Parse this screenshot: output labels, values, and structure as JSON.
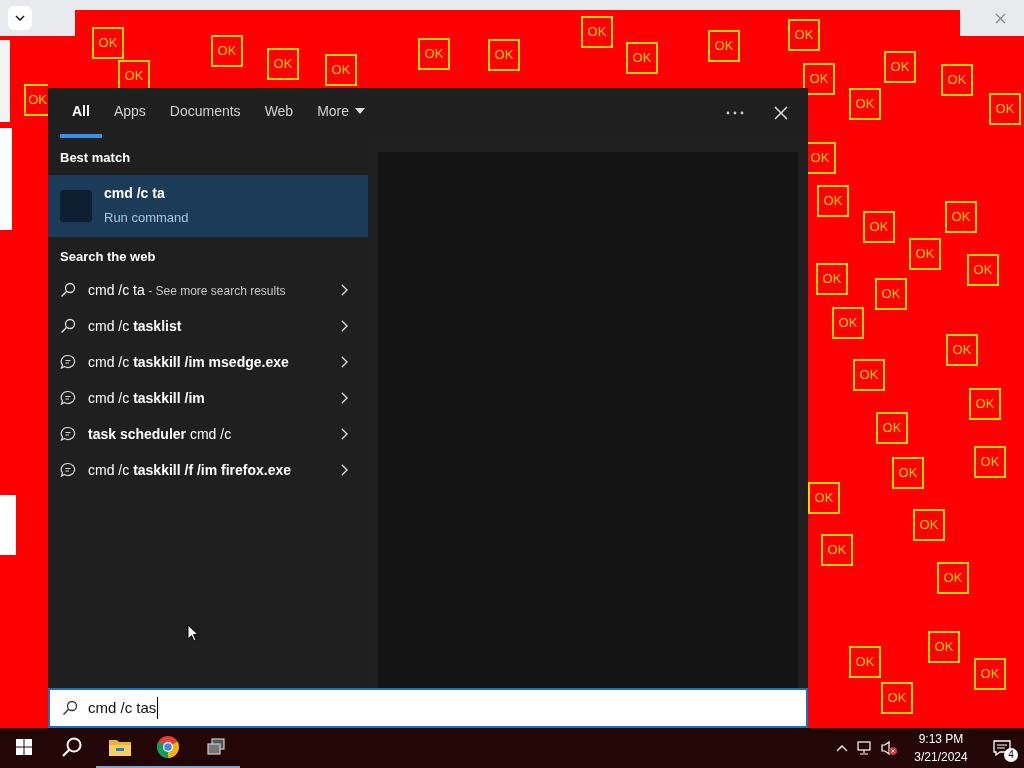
{
  "desktop": {
    "ok_buttons": [
      {
        "label": "OK"
      },
      {
        "label": "OK"
      },
      {
        "label": "OK"
      },
      {
        "label": "OK"
      },
      {
        "label": "OK"
      },
      {
        "label": "OK"
      },
      {
        "label": "OK"
      },
      {
        "label": "OK"
      },
      {
        "label": "OK"
      },
      {
        "label": "OK"
      },
      {
        "label": "OK"
      },
      {
        "label": "OK"
      },
      {
        "label": "OK"
      },
      {
        "label": "OK"
      },
      {
        "label": "OK"
      },
      {
        "label": "OK"
      },
      {
        "label": "OK"
      },
      {
        "label": "OK"
      },
      {
        "label": "OK"
      },
      {
        "label": "OK"
      },
      {
        "label": "OK"
      },
      {
        "label": "OK"
      },
      {
        "label": "OK"
      },
      {
        "label": "OK"
      },
      {
        "label": "OK"
      },
      {
        "label": "OK"
      },
      {
        "label": "OK"
      },
      {
        "label": "OK"
      },
      {
        "label": "OK"
      },
      {
        "label": "OK"
      },
      {
        "label": "OK"
      },
      {
        "label": "OK"
      },
      {
        "label": "OK"
      },
      {
        "label": "OK"
      },
      {
        "label": "OK"
      },
      {
        "label": "OK"
      },
      {
        "label": "OK"
      },
      {
        "label": "OK"
      },
      {
        "label": "OK"
      },
      {
        "label": "OK"
      }
    ]
  },
  "search_panel": {
    "tabs": [
      {
        "label": "All",
        "selected": true
      },
      {
        "label": "Apps",
        "selected": false
      },
      {
        "label": "Documents",
        "selected": false
      },
      {
        "label": "Web",
        "selected": false
      },
      {
        "label": "More",
        "selected": false,
        "kind": "dropdown"
      }
    ],
    "best_match": {
      "heading": "Best match",
      "title": "cmd /c ta",
      "subtitle": "Run command",
      "selected": true
    },
    "web_heading": "Search the web",
    "web_results": [
      {
        "kind": "search",
        "text": "cmd /c ta",
        "suffix": " - See more search results"
      },
      {
        "kind": "search",
        "text": "cmd /c **tasklist**"
      },
      {
        "kind": "suggestion",
        "text": "cmd /c **taskkill /im msedge.exe**"
      },
      {
        "kind": "suggestion",
        "text": "cmd /c **taskkill /im**"
      },
      {
        "kind": "suggestion",
        "text": "**task scheduler** cmd /c"
      },
      {
        "kind": "suggestion",
        "text": "cmd /c **taskkill /f /im firefox.exe**"
      }
    ],
    "search_box": {
      "value": "cmd /c tas"
    }
  },
  "taskbar": {
    "items": [
      {
        "kind": "start",
        "open": false
      },
      {
        "kind": "search",
        "open": false
      },
      {
        "kind": "folder",
        "open": true
      },
      {
        "kind": "browser",
        "open": true
      },
      {
        "kind": "taskview",
        "open": true
      }
    ],
    "time": "9:13 PM",
    "date": "3/21/2024",
    "notification_count": "4"
  }
}
